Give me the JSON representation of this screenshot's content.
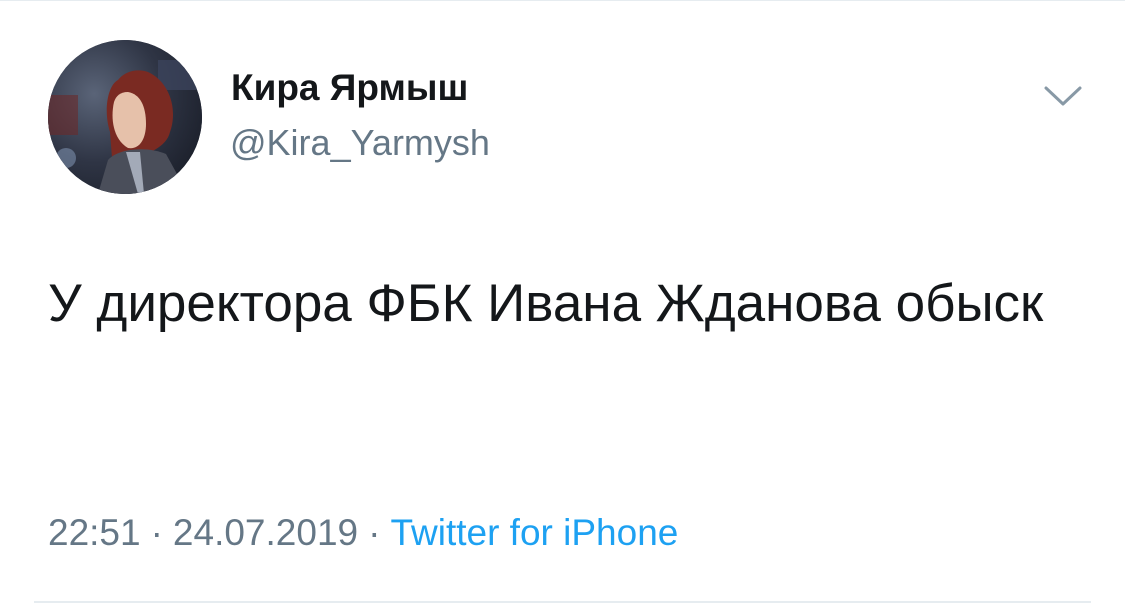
{
  "tweet": {
    "author": {
      "display_name": "Кира Ярмыш",
      "handle": "@Kira_Yarmysh",
      "avatar_icon": "profile-photo"
    },
    "menu_icon": "chevron-down-icon",
    "text": "У директора ФБК Ивана Жданова обыск",
    "meta": {
      "time": "22:51",
      "separator": "·",
      "date": "24.07.2019",
      "source": "Twitter for iPhone"
    },
    "colors": {
      "text": "#14171a",
      "secondary": "#657786",
      "link": "#1da1f2",
      "divider": "#e6ecf0"
    }
  }
}
